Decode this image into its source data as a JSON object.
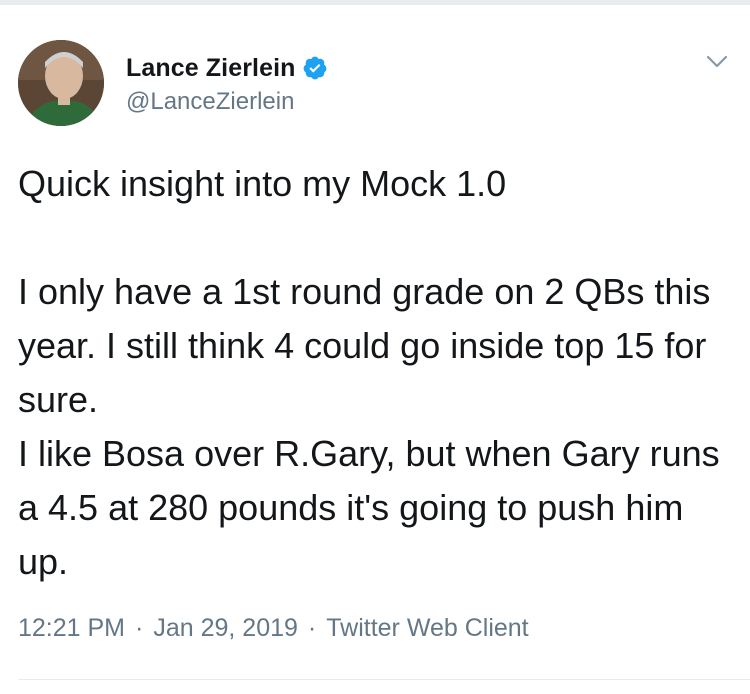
{
  "author": {
    "display_name": "Lance Zierlein",
    "handle": "@LanceZierlein",
    "verified": true
  },
  "tweet": {
    "text": "Quick insight into my Mock 1.0\n\nI only have a 1st round grade on 2 QBs this year. I still think 4 could go inside top 15 for sure.\nI like Bosa over R.Gary, but when Gary runs a 4.5 at 280 pounds it's going to push him up."
  },
  "meta": {
    "time": "12:21 PM",
    "date": "Jan 29, 2019",
    "source": "Twitter Web Client",
    "separator": "·"
  },
  "colors": {
    "text": "#14171a",
    "secondary": "#657786",
    "verified_blue": "#1da1f2",
    "divider": "#e6ecf0"
  },
  "icons": {
    "verified": "verified-badge-icon",
    "menu": "chevron-down-icon"
  }
}
